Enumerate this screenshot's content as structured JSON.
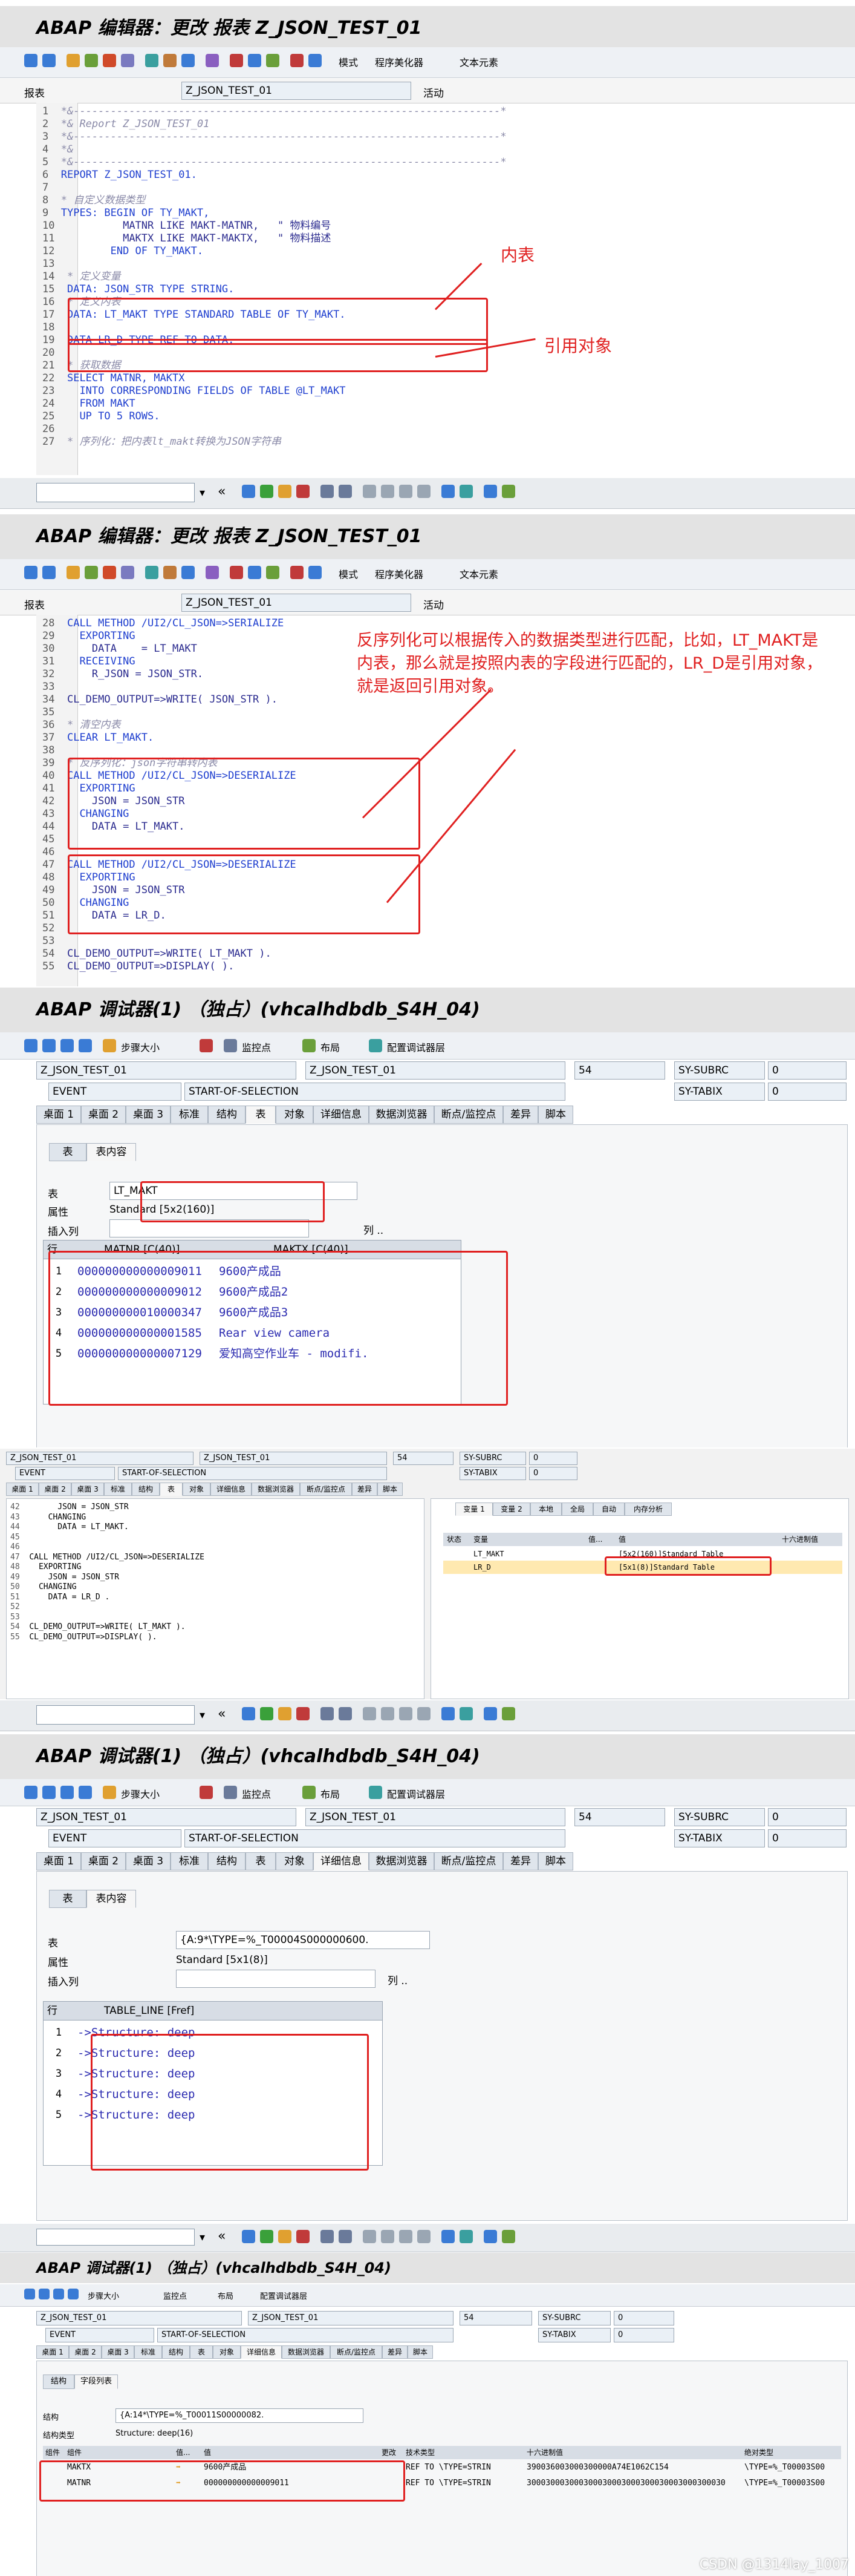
{
  "s1": {
    "title": "ABAP 编辑器：更改 报表 Z_JSON_TEST_01",
    "toolbar": [
      "模式",
      "程序美化器",
      "文本元素"
    ],
    "report_label": "报表",
    "report_value": "Z_JSON_TEST_01",
    "status": "活动",
    "lines": [
      {
        "n": "1",
        "t": "*&---------------------------------------------------------------------*",
        "c": "cm"
      },
      {
        "n": "2",
        "t": "*& Report Z_JSON_TEST_01",
        "c": "cm"
      },
      {
        "n": "3",
        "t": "*&---------------------------------------------------------------------*",
        "c": "cm"
      },
      {
        "n": "4",
        "t": "*&",
        "c": "cm"
      },
      {
        "n": "5",
        "t": "*&---------------------------------------------------------------------*",
        "c": "cm"
      },
      {
        "n": "6",
        "t": "REPORT Z_JSON_TEST_01.",
        "c": "kw"
      },
      {
        "n": "7",
        "t": "",
        "c": ""
      },
      {
        "n": "8",
        "t": "* 自定义数据类型",
        "c": "cm"
      },
      {
        "n": "9",
        "t": "TYPES: BEGIN OF TY_MAKT,",
        "c": "kw"
      },
      {
        "n": "10",
        "t": "         MATNR LIKE MAKT-MATNR,   \" 物料编号",
        "c": "pl"
      },
      {
        "n": "11",
        "t": "         MAKTX LIKE MAKT-MAKTX,   \" 物料描述",
        "c": "pl"
      },
      {
        "n": "12",
        "t": "       END OF TY_MAKT.",
        "c": "kw"
      },
      {
        "n": "13",
        "t": "",
        "c": ""
      },
      {
        "n": "14",
        "t": "* 定义变量",
        "c": "cm"
      },
      {
        "n": "15",
        "t": "DATA: JSON_STR TYPE STRING.",
        "c": "kw"
      },
      {
        "n": "16",
        "t": "* 定义内表",
        "c": "cm"
      },
      {
        "n": "17",
        "t": "DATA: LT_MAKT TYPE STANDARD TABLE OF TY_MAKT.",
        "c": "kw"
      },
      {
        "n": "18",
        "t": "",
        "c": ""
      },
      {
        "n": "19",
        "t": "DATA LR_D TYPE REF TO DATA.",
        "c": "kw"
      },
      {
        "n": "20",
        "t": "",
        "c": ""
      },
      {
        "n": "21",
        "t": "* 获取数据",
        "c": "cm"
      },
      {
        "n": "22",
        "t": "SELECT MATNR, MAKTX",
        "c": "kw"
      },
      {
        "n": "23",
        "t": "  INTO CORRESPONDING FIELDS OF TABLE @LT_MAKT",
        "c": "kw"
      },
      {
        "n": "24",
        "t": "  FROM MAKT",
        "c": "kw"
      },
      {
        "n": "25",
        "t": "  UP TO 5 ROWS.",
        "c": "kw"
      },
      {
        "n": "26",
        "t": "",
        "c": ""
      },
      {
        "n": "27",
        "t": "* 序列化：把内表lt_makt转换为JSON字符串",
        "c": "cm"
      }
    ],
    "ann_inner": "内表",
    "ann_ref": "引用对象"
  },
  "s2": {
    "title": "ABAP 编辑器：更改 报表 Z_JSON_TEST_01",
    "toolbar": [
      "模式",
      "程序美化器",
      "文本元素"
    ],
    "report_label": "报表",
    "report_value": "Z_JSON_TEST_01",
    "status": "活动",
    "lines": [
      {
        "n": "28",
        "t": "CALL METHOD /UI2/CL_JSON=>SERIALIZE",
        "c": "kw"
      },
      {
        "n": "29",
        "t": "  EXPORTING",
        "c": "kw"
      },
      {
        "n": "30",
        "t": "    DATA    = LT_MAKT",
        "c": "pl"
      },
      {
        "n": "31",
        "t": "  RECEIVING",
        "c": "kw"
      },
      {
        "n": "32",
        "t": "    R_JSON = JSON_STR.",
        "c": "pl"
      },
      {
        "n": "33",
        "t": "",
        "c": ""
      },
      {
        "n": "34",
        "t": "CL_DEMO_OUTPUT=>WRITE( JSON_STR ).",
        "c": "pl"
      },
      {
        "n": "35",
        "t": "",
        "c": ""
      },
      {
        "n": "36",
        "t": "* 清空内表",
        "c": "cm"
      },
      {
        "n": "37",
        "t": "CLEAR LT_MAKT.",
        "c": "kw"
      },
      {
        "n": "38",
        "t": "",
        "c": ""
      },
      {
        "n": "39",
        "t": "* 反序列化：json字符串转内表",
        "c": "cm"
      },
      {
        "n": "40",
        "t": "CALL METHOD /UI2/CL_JSON=>DESERIALIZE",
        "c": "kw"
      },
      {
        "n": "41",
        "t": "  EXPORTING",
        "c": "kw"
      },
      {
        "n": "42",
        "t": "    JSON = JSON_STR",
        "c": "pl"
      },
      {
        "n": "43",
        "t": "  CHANGING",
        "c": "kw"
      },
      {
        "n": "44",
        "t": "    DATA = LT_MAKT.",
        "c": "pl"
      },
      {
        "n": "45",
        "t": "",
        "c": ""
      },
      {
        "n": "46",
        "t": "",
        "c": ""
      },
      {
        "n": "47",
        "t": "CALL METHOD /UI2/CL_JSON=>DESERIALIZE",
        "c": "kw"
      },
      {
        "n": "48",
        "t": "  EXPORTING",
        "c": "kw"
      },
      {
        "n": "49",
        "t": "    JSON = JSON_STR",
        "c": "pl"
      },
      {
        "n": "50",
        "t": "  CHANGING",
        "c": "kw"
      },
      {
        "n": "51",
        "t": "    DATA = LR_D.",
        "c": "pl"
      },
      {
        "n": "52",
        "t": "",
        "c": ""
      },
      {
        "n": "53",
        "t": "",
        "c": ""
      },
      {
        "n": "54",
        "t": "CL_DEMO_OUTPUT=>WRITE( LT_MAKT ).",
        "c": "pl"
      },
      {
        "n": "55",
        "t": "CL_DEMO_OUTPUT=>DISPLAY( ).",
        "c": "pl"
      }
    ],
    "annotation": "反序列化可以根据传入的数据类型进行匹配，比如，LT_MAKT是内表，那么就是按照内表的字段进行匹配的，LR_D是引用对象，就是返回引用对象。"
  },
  "s3": {
    "title": "ABAP 调试器(1) （独占）(vhcalhdbdb_S4H_04)",
    "toolbar": [
      "步骤大小",
      "监控点",
      "布局",
      "配置调试器层"
    ],
    "prog1": "Z_JSON_TEST_01",
    "prog2": "Z_JSON_TEST_01",
    "event": "EVENT",
    "event_val": "START-OF-SELECTION",
    "line": "54",
    "sys1": "SY-SUBRC",
    "sys1v": "0",
    "sys2": "SY-TABIX",
    "sys2v": "0",
    "tabs": [
      "桌面 1",
      "桌面 2",
      "桌面 3",
      "标准",
      "结构",
      "表",
      "对象",
      "详细信息",
      "数据浏览器",
      "断点/监控点",
      "差异",
      "脚本"
    ],
    "subtabs": [
      "表",
      "表内容"
    ],
    "table_label": "表",
    "table_value": "LT_MAKT",
    "attr_label": "属性",
    "attr_value": "Standard [5x2(160)]",
    "insert_label": "插入列",
    "col_btn": "列 ..",
    "grid_row_hdr": "行",
    "col1": "MATNR [C(40)]",
    "col2": "MAKTX [C(40)]",
    "rows": [
      {
        "n": "1",
        "a": "000000000000009011",
        "b": "9600产成品"
      },
      {
        "n": "2",
        "a": "000000000000009012",
        "b": "9600产成品2"
      },
      {
        "n": "3",
        "a": "000000000010000347",
        "b": "9600产成品3"
      },
      {
        "n": "4",
        "a": "000000000000001585",
        "b": "Rear view camera"
      },
      {
        "n": "5",
        "a": "000000000000007129",
        "b": "爱知高空作业车 - modifi."
      }
    ]
  },
  "s4": {
    "prog1": "Z_JSON_TEST_01",
    "prog2": "Z_JSON_TEST_01",
    "event": "EVENT",
    "event_val": "START-OF-SELECTION",
    "line": "54",
    "sys1": "SY-SUBRC",
    "sys1v": "0",
    "sys2": "SY-TABIX",
    "sys2v": "0",
    "tabs": [
      "桌面 1",
      "桌面 2",
      "桌面 3",
      "标准",
      "结构",
      "表",
      "对象",
      "详细信息",
      "数据浏览器",
      "断点/监控点",
      "差异",
      "脚本"
    ],
    "code": [
      {
        "n": "42",
        "t": "      JSON = JSON_STR"
      },
      {
        "n": "43",
        "t": "    CHANGING"
      },
      {
        "n": "44",
        "t": "      DATA = LT_MAKT."
      },
      {
        "n": "45",
        "t": ""
      },
      {
        "n": "46",
        "t": ""
      },
      {
        "n": "47",
        "t": "CALL METHOD /UI2/CL_JSON=>DESERIALIZE"
      },
      {
        "n": "48",
        "t": "  EXPORTING"
      },
      {
        "n": "49",
        "t": "    JSON = JSON_STR"
      },
      {
        "n": "50",
        "t": "  CHANGING"
      },
      {
        "n": "51",
        "t": "    DATA = LR_D ."
      },
      {
        "n": "52",
        "t": ""
      },
      {
        "n": "53",
        "t": ""
      },
      {
        "n": "54",
        "t": "CL_DEMO_OUTPUT=>WRITE( LT_MAKT )."
      },
      {
        "n": "55",
        "t": "CL_DEMO_OUTPUT=>DISPLAY( )."
      }
    ],
    "var_tabs": [
      "变量 1",
      "变量 2",
      "本地",
      "全局",
      "自动",
      "内存分析"
    ],
    "var_cols": [
      "状态",
      "变量",
      "值...",
      "值",
      "十六进制值"
    ],
    "vars": [
      {
        "name": "LT_MAKT",
        "val": "[5x2(160)]Standard Table"
      },
      {
        "name": "LR_D",
        "val": "[5x1(8)]Standard Table"
      }
    ]
  },
  "s5": {
    "title": "ABAP 调试器(1) （独占）(vhcalhdbdb_S4H_04)",
    "toolbar": [
      "步骤大小",
      "监控点",
      "布局",
      "配置调试器层"
    ],
    "prog1": "Z_JSON_TEST_01",
    "prog2": "Z_JSON_TEST_01",
    "event": "EVENT",
    "event_val": "START-OF-SELECTION",
    "line": "54",
    "sys1": "SY-SUBRC",
    "sys1v": "0",
    "sys2": "SY-TABIX",
    "sys2v": "0",
    "tabs": [
      "桌面 1",
      "桌面 2",
      "桌面 3",
      "标准",
      "结构",
      "表",
      "对象",
      "详细信息",
      "数据浏览器",
      "断点/监控点",
      "差异",
      "脚本"
    ],
    "subtabs": [
      "表",
      "表内容"
    ],
    "table_label": "表",
    "table_value": "{A:9*\\TYPE=%_T00004S000000600.",
    "attr_label": "属性",
    "attr_value": "Standard [5x1(8)]",
    "insert_label": "插入列",
    "col_btn": "列 ..",
    "grid_row_hdr": "行",
    "col1": "TABLE_LINE [Fref]",
    "rows": [
      {
        "n": "1",
        "a": "->Structure: deep"
      },
      {
        "n": "2",
        "a": "->Structure: deep"
      },
      {
        "n": "3",
        "a": "->Structure: deep"
      },
      {
        "n": "4",
        "a": "->Structure: deep"
      },
      {
        "n": "5",
        "a": "->Structure: deep"
      }
    ]
  },
  "s6": {
    "title": "ABAP 调试器(1) （独占）(vhcalhdbdb_S4H_04)",
    "toolbar": [
      "步骤大小",
      "监控点",
      "布局",
      "配置调试器层"
    ],
    "prog1": "Z_JSON_TEST_01",
    "prog2": "Z_JSON_TEST_01",
    "event": "EVENT",
    "event_val": "START-OF-SELECTION",
    "line": "54",
    "sys1": "SY-SUBRC",
    "sys1v": "0",
    "sys2": "SY-TABIX",
    "sys2v": "0",
    "tabs": [
      "桌面 1",
      "桌面 2",
      "桌面 3",
      "标准",
      "结构",
      "表",
      "对象",
      "详细信息",
      "数据浏览器",
      "断点/监控点",
      "差异",
      "脚本"
    ],
    "subtabs": [
      "结构",
      "字段列表"
    ],
    "struct_label": "结构",
    "struct_value": "{A:14*\\TYPE=%_T00011S00000082.",
    "stype_label": "结构类型",
    "stype_value": "Structure: deep(16)",
    "cols": [
      "组件",
      "组件",
      "值...",
      "值",
      "更改",
      "技术类型",
      "十六进制值",
      "绝对类型"
    ],
    "rows": [
      {
        "comp": "MAKTX",
        "val": "9600产成品",
        "tech": "REF TO \\TYPE=STRIN",
        "hex": "390036003000300000A74E1062C154",
        "abs": "\\TYPE=%_T00003S00"
      },
      {
        "comp": "MATNR",
        "val": "000000000000009011",
        "tech": "REF TO \\TYPE=STRIN",
        "hex": "300030003000300030003000300030003000300030",
        "abs": "\\TYPE=%_T00003S00"
      }
    ]
  },
  "watermark": "CSDN @1314lay_1007",
  "colors": {
    "annotation": "#e02020",
    "keyword": "#1f3fcf",
    "comment": "#8a8aa8",
    "grid_text": "#2b2bb0"
  }
}
